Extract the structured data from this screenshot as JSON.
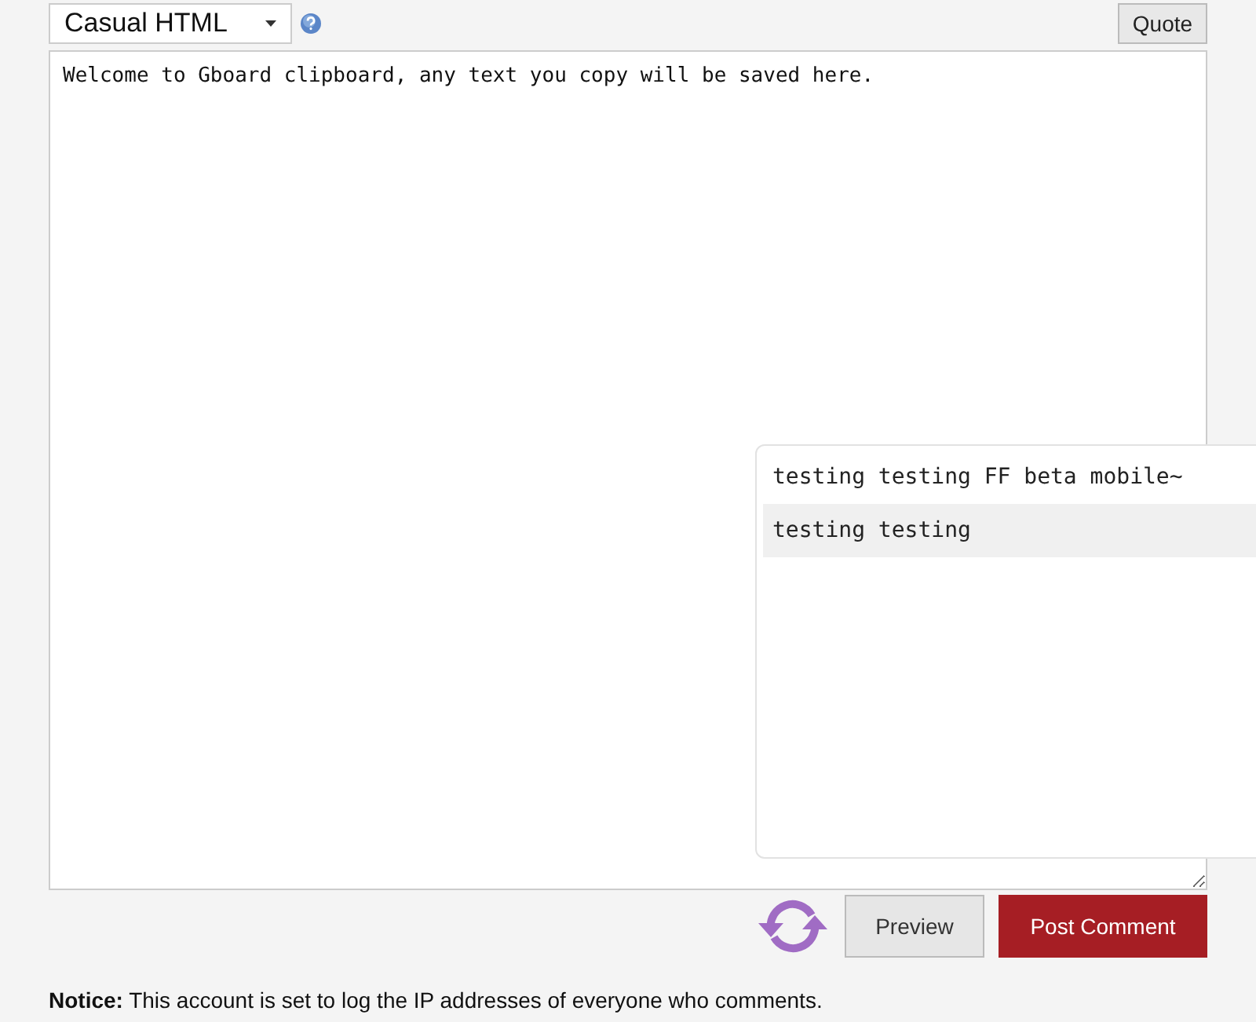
{
  "format_select": {
    "value": "Casual HTML"
  },
  "quote_button": "Quote",
  "comment": {
    "value": "Welcome to Gboard clipboard, any text you copy will be saved here."
  },
  "clipboard_items": [
    {
      "text": "testing testing FF beta mobile~",
      "selected": false
    },
    {
      "text": "testing testing",
      "selected": true
    }
  ],
  "buttons": {
    "preview": "Preview",
    "post": "Post Comment"
  },
  "notice": "**Notice:** This account is set to log the IP addresses of everyone who comments."
}
